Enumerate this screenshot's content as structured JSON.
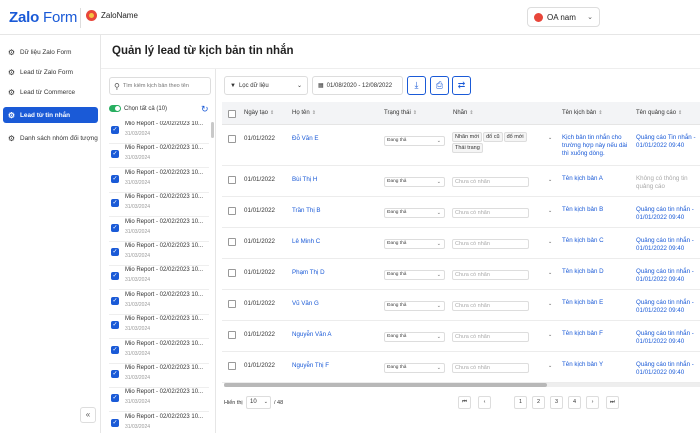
{
  "header": {
    "logo_brand": "Zalo",
    "logo_product": "Form",
    "account_name": "ZaloName",
    "oa_select": "OA nam"
  },
  "sidebar": {
    "items": [
      {
        "label": "Dữ liệu Zalo Form",
        "active": false
      },
      {
        "label": "Lead từ Zalo Form",
        "active": false
      },
      {
        "label": "Lead từ Commerce",
        "active": false
      },
      {
        "label": "Lead từ tin nhắn",
        "active": true
      },
      {
        "label": "Danh sách nhóm đối tượng",
        "active": false
      }
    ],
    "collapse": "«"
  },
  "page": {
    "title": "Quản lý lead từ kịch bản tin nhắn"
  },
  "scenario_panel": {
    "search_placeholder": "Tìm kiếm kịch bản theo tên",
    "select_all": "Chọn tất cả (10)",
    "items": [
      {
        "name": "Mio Report - 02/02/2023 10...",
        "date": "31/03/2024"
      },
      {
        "name": "Mio Report - 02/02/2023 10...",
        "date": "31/03/2024"
      },
      {
        "name": "Mio Report - 02/02/2023 10...",
        "date": "31/03/2024"
      },
      {
        "name": "Mio Report - 02/02/2023 10...",
        "date": "31/03/2024"
      },
      {
        "name": "Mio Report - 02/02/2023 10...",
        "date": "31/03/2024"
      },
      {
        "name": "Mio Report - 02/02/2023 10...",
        "date": "31/03/2024"
      },
      {
        "name": "Mio Report - 02/02/2023 10...",
        "date": "31/03/2024"
      },
      {
        "name": "Mio Report - 02/02/2023 10...",
        "date": "31/03/2024"
      },
      {
        "name": "Mio Report - 02/02/2023 10...",
        "date": "31/03/2024"
      },
      {
        "name": "Mio Report - 02/02/2023 10...",
        "date": "31/03/2024"
      },
      {
        "name": "Mio Report - 02/02/2023 10...",
        "date": "31/03/2024"
      },
      {
        "name": "Mio Report - 02/02/2023 10...",
        "date": "31/03/2024"
      },
      {
        "name": "Mio Report - 02/02/2023 10...",
        "date": "31/03/2024"
      }
    ]
  },
  "toolbar": {
    "filter_label": "Lọc dữ liệu",
    "date_range": "01/08/2020 - 12/08/2022"
  },
  "table": {
    "headers": [
      "Ngày tạo",
      "Họ tên",
      "Trạng thái",
      "Nhãn",
      "Tên kịch bản",
      "Tên quảng cáo"
    ],
    "status_value": "Đang thả",
    "label_placeholder": "Chưa có nhãn",
    "rows": [
      {
        "date": "01/01/2022",
        "name": "Đỗ Văn E",
        "status": "Đang thả",
        "tags": [
          "Nhãn mới",
          "đổ cũ",
          "đổ mới",
          "Thái trang"
        ],
        "scenario": "Kịch bản tin nhắn cho trường hợp này nếu dài thì xuống dòng.",
        "ad": "Quảng cáo Tin nhắn - 01/01/2022 09:40",
        "ad_muted": false
      },
      {
        "date": "01/01/2022",
        "name": "Bùi Thị H",
        "status": "Đang thả",
        "tags": [],
        "scenario": "Tên kịch bản A",
        "ad": "Không có thông tin quảng cáo",
        "ad_muted": true
      },
      {
        "date": "01/01/2022",
        "name": "Trần Thị B",
        "status": "Đang thả",
        "tags": [],
        "scenario": "Tên kịch bản B",
        "ad": "Quảng cáo tin nhắn - 01/01/2022 09:40",
        "ad_muted": false
      },
      {
        "date": "01/01/2022",
        "name": "Lê Minh C",
        "status": "Đang thả",
        "tags": [],
        "scenario": "Tên kịch bản C",
        "ad": "Quảng cáo tin nhắn - 01/01/2022 09:40",
        "ad_muted": false
      },
      {
        "date": "01/01/2022",
        "name": "Phạm Thị D",
        "status": "Đang thả",
        "tags": [],
        "scenario": "Tên kịch bản D",
        "ad": "Quảng cáo tin nhắn - 01/01/2022 09:40",
        "ad_muted": false
      },
      {
        "date": "01/01/2022",
        "name": "Vũ Văn G",
        "status": "Đang thả",
        "tags": [],
        "scenario": "Tên kịch bản E",
        "ad": "Quảng cáo tin nhắn - 01/01/2022 09:40",
        "ad_muted": false
      },
      {
        "date": "01/01/2022",
        "name": "Nguyễn Văn A",
        "status": "Đang thả",
        "tags": [],
        "scenario": "Tên kịch bản F",
        "ad": "Quảng cáo tin nhắn - 01/01/2022 09:40",
        "ad_muted": false
      },
      {
        "date": "01/01/2022",
        "name": "Nguyễn Thị F",
        "status": "Đang thả",
        "tags": [],
        "scenario": "Tên kịch bản Y",
        "ad": "Quảng cáo tin nhắn - 01/01/2022 09:40",
        "ad_muted": false
      }
    ]
  },
  "pagination": {
    "show_label": "Hiển thị",
    "page_size": "10",
    "total": "/ 48",
    "pages": [
      "1",
      "2",
      "3",
      "4"
    ]
  },
  "colors": {
    "primary": "#1a5ad7",
    "toggle": "#27ae60"
  }
}
